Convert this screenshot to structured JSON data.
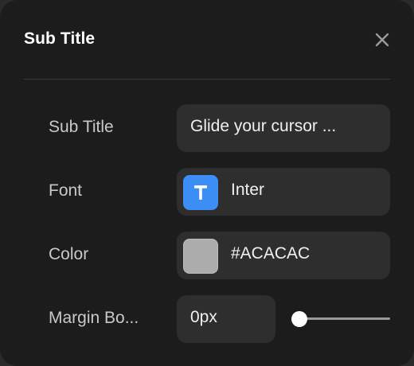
{
  "panel": {
    "title": "Sub Title"
  },
  "rows": {
    "subtitle": {
      "label": "Sub Title",
      "value": "Glide your cursor ..."
    },
    "font": {
      "label": "Font",
      "value": "Inter",
      "icon": "font-T-icon",
      "icon_color": "#3d8ef5"
    },
    "color": {
      "label": "Color",
      "value": "#ACACAC",
      "swatch_color": "#ACACAC"
    },
    "margin_bottom": {
      "label": "Margin Bo...",
      "value": "0px",
      "slider_value": 0
    }
  },
  "colors": {
    "panel_background": "#1c1c1c",
    "field_background": "#2e2e2e",
    "accent": "#3d8ef5"
  }
}
